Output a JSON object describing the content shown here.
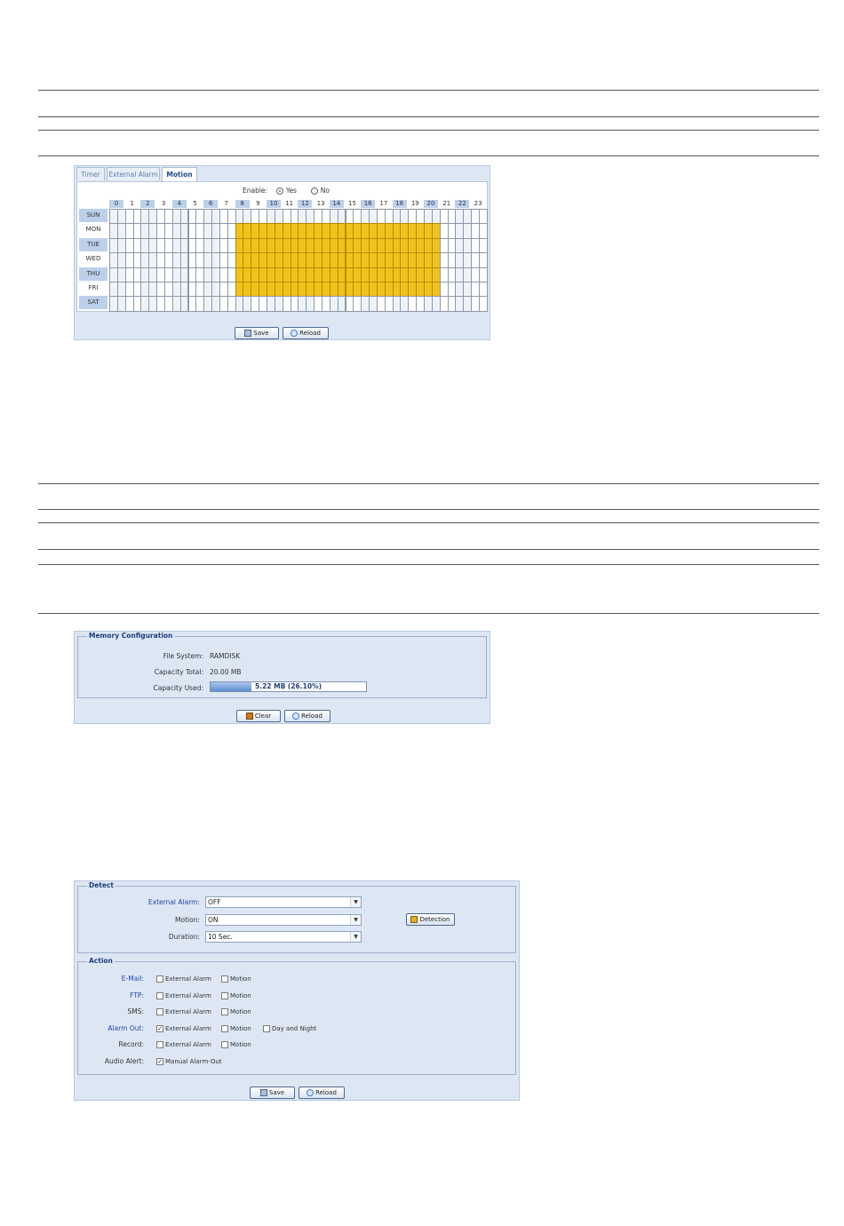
{
  "schedule": {
    "tabs": [
      "Timer",
      "External Alarm",
      "Motion"
    ],
    "active_tab": 2,
    "enable_label": "Enable:",
    "enable_yes": "Yes",
    "enable_no": "No",
    "enable_value": "Yes",
    "hours": [
      "0",
      "1",
      "2",
      "3",
      "4",
      "5",
      "6",
      "7",
      "8",
      "9",
      "10",
      "11",
      "12",
      "13",
      "14",
      "15",
      "16",
      "17",
      "18",
      "19",
      "20",
      "21",
      "22",
      "23"
    ],
    "days": [
      "SUN",
      "MON",
      "TUE",
      "WED",
      "THU",
      "FRI",
      "SAT"
    ],
    "active_days": [
      "MON",
      "TUE",
      "WED",
      "THU",
      "FRI"
    ],
    "active_from_hour": 8,
    "active_to_hour": 21,
    "save_label": "Save",
    "reload_label": "Reload",
    "accent_color": "#f2c21c"
  },
  "memory": {
    "legend": "Memory Configuration",
    "file_system_label": "File System:",
    "file_system_value": "RAMDISK",
    "capacity_total_label": "Capacity Total:",
    "capacity_total_value": "20.00 MB",
    "capacity_used_label": "Capacity Used:",
    "capacity_used_value": "5.22 MB (26.10%)",
    "capacity_used_fraction": 0.261,
    "clear_label": "Clear",
    "reload_label": "Reload"
  },
  "event": {
    "detect_legend": "Detect",
    "external_alarm_label": "External Alarm:",
    "external_alarm_value": "OFF",
    "motion_label": "Motion:",
    "motion_value": "ON",
    "duration_label": "Duration:",
    "duration_value": "10 Sec.",
    "detection_label": "Detection",
    "action_legend": "Action",
    "actions": [
      {
        "label": "E-Mail:",
        "link": true,
        "options": [
          {
            "text": "External Alarm",
            "checked": false
          },
          {
            "text": "Motion",
            "checked": false
          }
        ]
      },
      {
        "label": "FTP:",
        "link": true,
        "options": [
          {
            "text": "External Alarm",
            "checked": false
          },
          {
            "text": "Motion",
            "checked": false
          }
        ]
      },
      {
        "label": "SMS:",
        "link": false,
        "options": [
          {
            "text": "External Alarm",
            "checked": false
          },
          {
            "text": "Motion",
            "checked": false
          }
        ]
      },
      {
        "label": "Alarm Out:",
        "link": true,
        "options": [
          {
            "text": "External Alarm",
            "checked": true
          },
          {
            "text": "Motion",
            "checked": false
          },
          {
            "text": "Day and Night",
            "checked": false
          }
        ]
      },
      {
        "label": "Record:",
        "link": false,
        "options": [
          {
            "text": "External Alarm",
            "checked": false
          },
          {
            "text": "Motion",
            "checked": false
          }
        ]
      },
      {
        "label": "Audio Alert:",
        "link": false,
        "options": [
          {
            "text": "Manual Alarm-Out",
            "checked": true
          }
        ]
      }
    ],
    "save_label": "Save",
    "reload_label": "Reload"
  }
}
